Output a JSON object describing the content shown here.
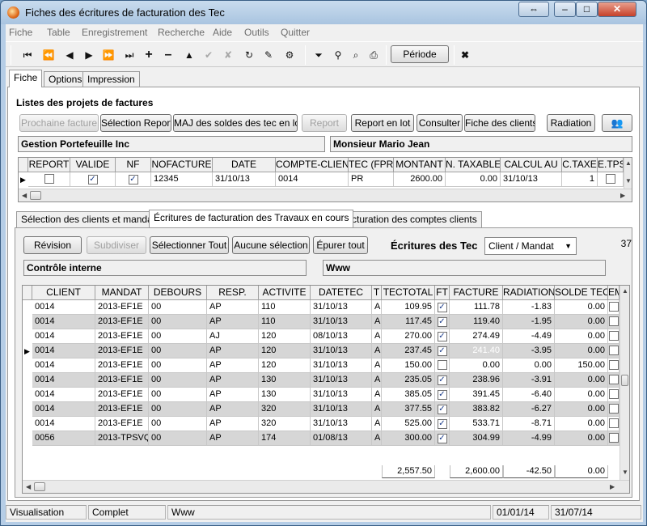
{
  "window": {
    "title": "Fiches des écritures de facturation des Tec"
  },
  "menu": [
    "Fiche",
    "Table",
    "Enregistrement",
    "Recherche",
    "Aide",
    "Outils",
    "Quitter"
  ],
  "toolbar": {
    "periode_label": "Période"
  },
  "main_tabs": [
    "Fiche",
    "Options",
    "Impression"
  ],
  "top": {
    "section_title": "Listes des projets de factures",
    "buttons": [
      "Prochaine facture",
      "Sélection Report",
      "MAJ des soldes des tec en lot",
      "Report",
      "Report en lot",
      "Consulter",
      "Fiche des clients",
      "Radiation"
    ],
    "client_name": "Gestion Portefeuille Inc",
    "contact_name": "Monsieur Mario Jean",
    "grid": {
      "columns": [
        "REPORT",
        "VALIDE",
        "NF",
        "NOFACTURE",
        "DATE",
        "COMPTE-CLIENT",
        "TEC (FPR)",
        "MONTANT",
        "N. TAXABLE",
        "CALCUL AU",
        "C.TAXE",
        "E.TPS"
      ],
      "row": {
        "report": false,
        "valide": true,
        "nf": true,
        "nofacture": "12345",
        "date": "31/10/13",
        "compte_client": "0014",
        "tec": "PR",
        "montant": "2600.00",
        "n_taxable": "0.00",
        "calcul_au": "31/10/13",
        "c_taxe": "1",
        "e_tps": false
      }
    }
  },
  "sub_tabs": [
    "Sélection des clients et mandats",
    "Écritures de facturation des Travaux en cours",
    "Facturation des comptes clients"
  ],
  "bottom": {
    "buttons": [
      "Révision",
      "Subdiviser",
      "Sélectionner Tout",
      "Aucune sélection",
      "Épurer tout"
    ],
    "section_title": "Écritures des Tec",
    "select_value": "Client / Mandat",
    "count": "37",
    "field_left": "Contrôle interne",
    "field_right": "Www",
    "columns": [
      "CLIENT",
      "MANDAT",
      "DEBOURS",
      "RESP.",
      "ACTIVITE",
      "DATETEC",
      "T",
      "TECTOTAL",
      "FT",
      "FACTURE",
      "RADIATION",
      "SOLDE TEC",
      "EM"
    ],
    "rows": [
      {
        "client": "0014",
        "mandat": "2013-EF1E",
        "debours": "00",
        "resp": "AP",
        "activite": "110",
        "datetec": "31/10/13",
        "t": "A",
        "tectotal": "109.95",
        "ft": true,
        "facture": "111.78",
        "radiation": "-1.83",
        "solde": "0.00"
      },
      {
        "client": "0014",
        "mandat": "2013-EF1E",
        "debours": "00",
        "resp": "AP",
        "activite": "110",
        "datetec": "31/10/13",
        "t": "A",
        "tectotal": "117.45",
        "ft": true,
        "facture": "119.40",
        "radiation": "-1.95",
        "solde": "0.00"
      },
      {
        "client": "0014",
        "mandat": "2013-EF1E",
        "debours": "00",
        "resp": "AJ",
        "activite": "120",
        "datetec": "08/10/13",
        "t": "A",
        "tectotal": "270.00",
        "ft": true,
        "facture": "274.49",
        "radiation": "-4.49",
        "solde": "0.00"
      },
      {
        "client": "0014",
        "mandat": "2013-EF1E",
        "debours": "00",
        "resp": "AP",
        "activite": "120",
        "datetec": "31/10/13",
        "t": "A",
        "tectotal": "237.45",
        "ft": true,
        "facture": "241.40",
        "radiation": "-3.95",
        "solde": "0.00"
      },
      {
        "client": "0014",
        "mandat": "2013-EF1E",
        "debours": "00",
        "resp": "AP",
        "activite": "120",
        "datetec": "31/10/13",
        "t": "A",
        "tectotal": "150.00",
        "ft": false,
        "facture": "0.00",
        "radiation": "0.00",
        "solde": "150.00"
      },
      {
        "client": "0014",
        "mandat": "2013-EF1E",
        "debours": "00",
        "resp": "AP",
        "activite": "130",
        "datetec": "31/10/13",
        "t": "A",
        "tectotal": "235.05",
        "ft": true,
        "facture": "238.96",
        "radiation": "-3.91",
        "solde": "0.00"
      },
      {
        "client": "0014",
        "mandat": "2013-EF1E",
        "debours": "00",
        "resp": "AP",
        "activite": "130",
        "datetec": "31/10/13",
        "t": "A",
        "tectotal": "385.05",
        "ft": true,
        "facture": "391.45",
        "radiation": "-6.40",
        "solde": "0.00"
      },
      {
        "client": "0014",
        "mandat": "2013-EF1E",
        "debours": "00",
        "resp": "AP",
        "activite": "320",
        "datetec": "31/10/13",
        "t": "A",
        "tectotal": "377.55",
        "ft": true,
        "facture": "383.82",
        "radiation": "-6.27",
        "solde": "0.00"
      },
      {
        "client": "0014",
        "mandat": "2013-EF1E",
        "debours": "00",
        "resp": "AP",
        "activite": "320",
        "datetec": "31/10/13",
        "t": "A",
        "tectotal": "525.00",
        "ft": true,
        "facture": "533.71",
        "radiation": "-8.71",
        "solde": "0.00"
      },
      {
        "client": "0056",
        "mandat": "2013-TPSVQ",
        "debours": "00",
        "resp": "AP",
        "activite": "174",
        "datetec": "01/08/13",
        "t": "A",
        "tectotal": "300.00",
        "ft": true,
        "facture": "304.99",
        "radiation": "-4.99",
        "solde": "0.00"
      }
    ],
    "totals": {
      "tectotal": "2,557.50",
      "facture": "2,600.00",
      "radiation": "-42.50",
      "solde": "0.00"
    }
  },
  "status": [
    "Visualisation",
    "Complet",
    "Www",
    "01/01/14",
    "31/07/14"
  ]
}
